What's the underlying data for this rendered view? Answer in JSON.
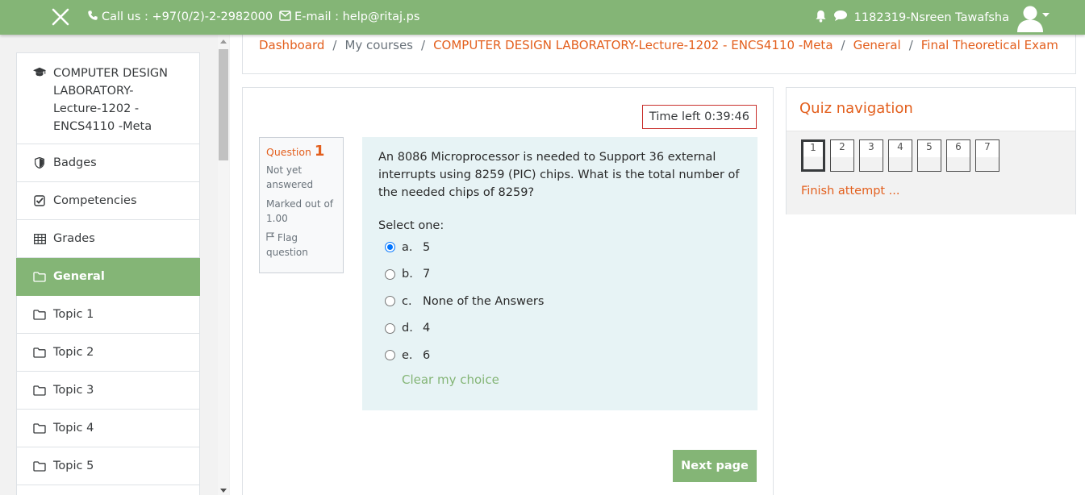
{
  "navbar": {
    "contact_phone": "Call us : +97(0/2)-2-2982000",
    "contact_email": "E-mail : help@ritaj.ps",
    "user_name": "1182319-Nsreen Tawafsha",
    "icons": [
      "close-icon",
      "phone-icon",
      "envelope-icon",
      "bell-icon",
      "chat-icon",
      "user-avatar-icon",
      "caret-down-icon"
    ],
    "bg_color": "#84b576"
  },
  "drawer": {
    "course": "COMPUTER DESIGN LABORATORY-Lecture-1202 - ENCS4110 -Meta",
    "items": [
      {
        "label": "Badges",
        "icon": "shield-icon"
      },
      {
        "label": "Competencies",
        "icon": "check-square-icon"
      },
      {
        "label": "Grades",
        "icon": "table-icon"
      },
      {
        "label": "General",
        "icon": "folder-icon",
        "active": true
      },
      {
        "label": "Topic 1",
        "icon": "folder-icon"
      },
      {
        "label": "Topic 2",
        "icon": "folder-icon"
      },
      {
        "label": "Topic 3",
        "icon": "folder-icon"
      },
      {
        "label": "Topic 4",
        "icon": "folder-icon"
      },
      {
        "label": "Topic 5",
        "icon": "folder-icon"
      }
    ]
  },
  "breadcrumb": {
    "dashboard": "Dashboard",
    "my_courses": "My courses",
    "course": "COMPUTER DESIGN LABORATORY-Lecture-1202 - ENCS4110 -Meta",
    "section": "General",
    "exam": "Final Theoretical Exam",
    "separator": "/"
  },
  "quiz": {
    "timer": "Time left 0:39:46",
    "question_label": "Question",
    "question_number": "1",
    "state": "Not yet answered",
    "marked_out_of": "Marked out of 1.00",
    "flag": "Flag question",
    "question_text": "An 8086 Microprocessor is needed to Support 36 external interrupts using 8259 (PIC) chips. What is the total number of the needed chips of 8259?",
    "prompt": "Select one:",
    "answers": [
      {
        "letter": "a.",
        "text": "5",
        "selected": true
      },
      {
        "letter": "b.",
        "text": "7",
        "selected": false
      },
      {
        "letter": "c.",
        "text": "None of the Answers",
        "selected": false
      },
      {
        "letter": "d.",
        "text": "4",
        "selected": false
      },
      {
        "letter": "e.",
        "text": "6",
        "selected": false
      }
    ],
    "clear_choice": "Clear my choice",
    "next_button": "Next page"
  },
  "quiz_navigation": {
    "title": "Quiz navigation",
    "questions": [
      "1",
      "2",
      "3",
      "4",
      "5",
      "6",
      "7"
    ],
    "current": "1",
    "finish": "Finish attempt ..."
  },
  "colors": {
    "accent_green": "#84b576",
    "link_orange": "#e35f1d",
    "question_bg": "#e7f3f5"
  }
}
